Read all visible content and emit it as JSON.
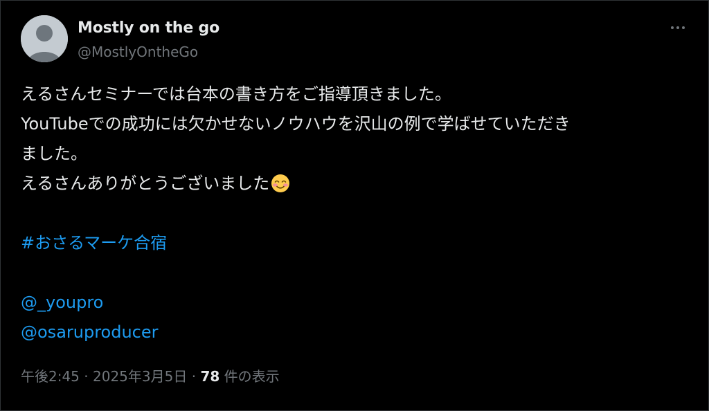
{
  "author": {
    "display_name": "Mostly on the go",
    "handle": "@MostlyOntheGo"
  },
  "post": {
    "lines": [
      "えるさんセミナーでは台本の書き方をご指導頂きました。",
      "YouTubeでの成功には欠かせないノウハウを沢山の例で学ばせていただき",
      "ました。",
      "えるさんありがとうございました"
    ],
    "hashtag": "#おさるマーケ合宿",
    "mentions": [
      "@_youpro",
      "@osaruproducer"
    ]
  },
  "meta": {
    "time": "午後2:45",
    "separator": "·",
    "date": "2025年3月5日",
    "views_count": "78",
    "views_label": "件の表示"
  },
  "icons": {
    "avatar": "default-avatar-icon",
    "more": "more-options-icon",
    "emoji": "smiling-face-with-smiling-eyes-emoji"
  },
  "colors": {
    "background": "#000000",
    "text": "#e7e9ea",
    "secondary": "#71767b",
    "link": "#1d9bf0"
  }
}
